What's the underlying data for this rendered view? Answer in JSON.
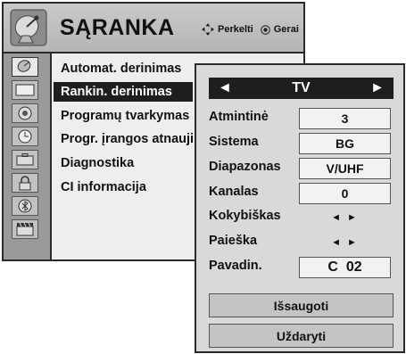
{
  "menu": {
    "title": "SĄRANKA",
    "hints": {
      "move": "Perkelti",
      "ok": "Gerai"
    },
    "items": [
      {
        "label": "Automat. derinimas"
      },
      {
        "label": "Rankin. derinimas"
      },
      {
        "label": "Programų tvarkymas"
      },
      {
        "label": "Progr. įrangos atnaujin"
      },
      {
        "label": "Diagnostika"
      },
      {
        "label": "CI informacija"
      }
    ],
    "side_icons": [
      "satellite-dish-icon",
      "tv-screen-icon",
      "speaker-icon",
      "clock-icon",
      "toolbox-icon",
      "lock-icon",
      "bluetooth-icon",
      "clapperboard-icon"
    ]
  },
  "manual_tuning": {
    "mode": "TV",
    "fields": [
      {
        "label": "Atmintinė",
        "value": "3"
      },
      {
        "label": "Sistema",
        "value": "BG"
      },
      {
        "label": "Diapazonas",
        "value": "V/UHF"
      },
      {
        "label": "Kanalas",
        "value": "0"
      },
      {
        "label": "Kokybiškas",
        "value": "◄ ►"
      },
      {
        "label": "Paieška",
        "value": "◄ ►"
      },
      {
        "label": "Pavadin.",
        "value": "C  02"
      }
    ],
    "save_label": "Išsaugoti",
    "close_label": "Uždaryti"
  },
  "colors": {
    "highlight": "#1e1e1e",
    "panel": "#d9d9d9",
    "sidebar": "#9a9a9a"
  }
}
